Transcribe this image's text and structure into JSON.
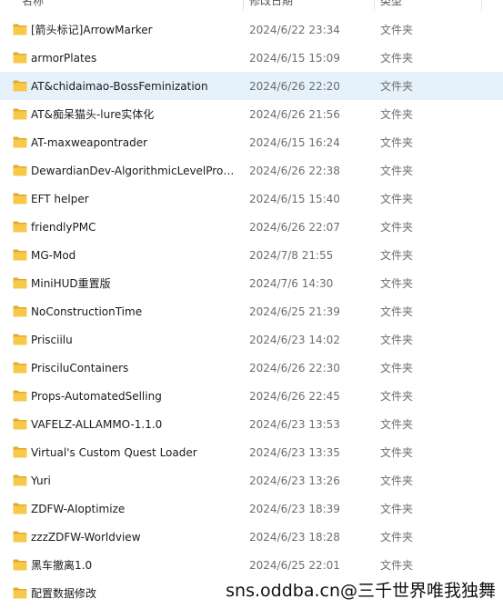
{
  "header": {
    "name": "名称",
    "date": "修改日期",
    "type": "类型"
  },
  "colors": {
    "folder_yellow": "#f7c948",
    "folder_dark": "#e0a82e",
    "selected_row": "#e5f1fb"
  },
  "files": [
    {
      "name": "[箭头标记]ArrowMarker",
      "date": "2024/6/22 23:34",
      "type": "文件夹",
      "icon": "folder-icon"
    },
    {
      "name": "armorPlates",
      "date": "2024/6/15 15:09",
      "type": "文件夹",
      "icon": "folder-icon"
    },
    {
      "name": "AT&chidaimao-BossFeminization",
      "date": "2024/6/26 22:20",
      "type": "文件夹",
      "icon": "folder-icon",
      "selected": true
    },
    {
      "name": "AT&痴呆猫头-lure实体化",
      "date": "2024/6/26 21:56",
      "type": "文件夹",
      "icon": "folder-icon"
    },
    {
      "name": "AT-maxweapontrader",
      "date": "2024/6/15 16:24",
      "type": "文件夹",
      "icon": "folder-icon"
    },
    {
      "name": "DewardianDev-AlgorithmicLevelProgr...",
      "date": "2024/6/26 22:38",
      "type": "文件夹",
      "icon": "folder-icon"
    },
    {
      "name": "EFT helper",
      "date": "2024/6/15 15:40",
      "type": "文件夹",
      "icon": "folder-icon"
    },
    {
      "name": "friendlyPMC",
      "date": "2024/6/26 22:07",
      "type": "文件夹",
      "icon": "folder-icon"
    },
    {
      "name": "MG-Mod",
      "date": "2024/7/8 21:55",
      "type": "文件夹",
      "icon": "folder-icon"
    },
    {
      "name": "MiniHUD重置版",
      "date": "2024/7/6 14:30",
      "type": "文件夹",
      "icon": "folder-icon"
    },
    {
      "name": "NoConstructionTime",
      "date": "2024/6/25 21:39",
      "type": "文件夹",
      "icon": "folder-icon"
    },
    {
      "name": "Prisciilu",
      "date": "2024/6/23 14:02",
      "type": "文件夹",
      "icon": "folder-icon"
    },
    {
      "name": "PrisciluContainers",
      "date": "2024/6/26 22:30",
      "type": "文件夹",
      "icon": "folder-icon"
    },
    {
      "name": "Props-AutomatedSelling",
      "date": "2024/6/26 22:45",
      "type": "文件夹",
      "icon": "folder-icon"
    },
    {
      "name": "VAFELZ-ALLAMMO-1.1.0",
      "date": "2024/6/23 13:53",
      "type": "文件夹",
      "icon": "folder-icon"
    },
    {
      "name": "Virtual's Custom Quest Loader",
      "date": "2024/6/23 13:35",
      "type": "文件夹",
      "icon": "folder-icon"
    },
    {
      "name": "Yuri",
      "date": "2024/6/23 13:26",
      "type": "文件夹",
      "icon": "folder-icon"
    },
    {
      "name": "ZDFW-AIoptimize",
      "date": "2024/6/23 18:39",
      "type": "文件夹",
      "icon": "folder-icon"
    },
    {
      "name": "zzzZDFW-Worldview",
      "date": "2024/6/23 18:28",
      "type": "文件夹",
      "icon": "folder-icon"
    },
    {
      "name": "黑车撤离1.0",
      "date": "2024/6/25 22:01",
      "type": "文件夹",
      "icon": "folder-icon"
    },
    {
      "name": "配置数据修改",
      "date": "",
      "type": "",
      "icon": "folder-icon"
    }
  ],
  "watermark": "sns.oddba.cn@三千世界唯我独舞"
}
